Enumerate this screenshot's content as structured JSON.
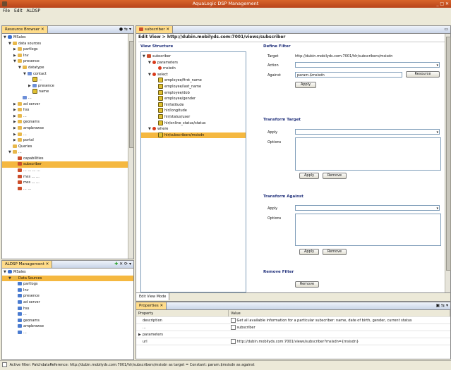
{
  "window": {
    "title": "AquaLogic DSP Management"
  },
  "menu": {
    "file": "File",
    "edit": "Edit",
    "aldsp": "ALDSP"
  },
  "left_panel": {
    "tab": "Resource Browser",
    "items": [
      {
        "label": "MSales",
        "indent": 0,
        "icon": "db",
        "tri": "▼"
      },
      {
        "label": "data sources",
        "indent": 1,
        "icon": "folder",
        "tri": "▼"
      },
      {
        "label": "partlogs",
        "indent": 2,
        "icon": "folder",
        "tri": "▶"
      },
      {
        "label": "Inv",
        "indent": 2,
        "icon": "folder",
        "tri": "▶"
      },
      {
        "label": "presence",
        "indent": 2,
        "icon": "folder",
        "tri": "▼"
      },
      {
        "label": "datatype",
        "indent": 3,
        "icon": "folder",
        "tri": "▼"
      },
      {
        "label": "contact",
        "indent": 4,
        "icon": "cube",
        "tri": "▼"
      },
      {
        "label": "...",
        "indent": 5,
        "icon": "col",
        "tri": ""
      },
      {
        "label": "presence",
        "indent": 5,
        "icon": "cube",
        "tri": "▶"
      },
      {
        "label": "name",
        "indent": 5,
        "icon": "col",
        "tri": ""
      },
      {
        "label": "...",
        "indent": 3,
        "icon": "cube",
        "tri": ""
      },
      {
        "label": "ad server",
        "indent": 2,
        "icon": "folder",
        "tri": "▶"
      },
      {
        "label": "hss",
        "indent": 2,
        "icon": "folder",
        "tri": "▶"
      },
      {
        "label": "...",
        "indent": 2,
        "icon": "folder",
        "tri": "▶"
      },
      {
        "label": "geonams",
        "indent": 2,
        "icon": "folder",
        "tri": "▶"
      },
      {
        "label": "ampbrowse",
        "indent": 2,
        "icon": "folder",
        "tri": "▶"
      },
      {
        "label": "...",
        "indent": 2,
        "icon": "folder",
        "tri": "▶"
      },
      {
        "label": "portal",
        "indent": 2,
        "icon": "folder",
        "tri": "▶"
      },
      {
        "label": "Queries",
        "indent": 1,
        "icon": "folder",
        "tri": ""
      },
      {
        "label": "...",
        "indent": 1,
        "icon": "folder",
        "tri": "▼"
      },
      {
        "label": "capabilities",
        "indent": 2,
        "icon": "view",
        "tri": ""
      },
      {
        "label": "subscriber",
        "indent": 2,
        "icon": "view",
        "tri": "",
        "selected": true
      },
      {
        "label": "... ... ... ...",
        "indent": 2,
        "icon": "view",
        "tri": ""
      },
      {
        "label": "mss ... ...",
        "indent": 2,
        "icon": "view",
        "tri": ""
      },
      {
        "label": "mss ... ...",
        "indent": 2,
        "icon": "view",
        "tri": ""
      },
      {
        "label": "... ...",
        "indent": 2,
        "icon": "view",
        "tri": ""
      }
    ]
  },
  "left_bottom_panel": {
    "tab": "ALDSP Management",
    "items": [
      {
        "label": "MSales",
        "indent": 0,
        "icon": "db",
        "tri": "▼"
      },
      {
        "label": "Data Sources",
        "indent": 1,
        "icon": "folder",
        "tri": "▼",
        "selected": true
      },
      {
        "label": "partlogs",
        "indent": 2,
        "icon": "table",
        "tri": ""
      },
      {
        "label": "Inv",
        "indent": 2,
        "icon": "table",
        "tri": ""
      },
      {
        "label": "presence",
        "indent": 2,
        "icon": "table",
        "tri": ""
      },
      {
        "label": "ad server",
        "indent": 2,
        "icon": "table",
        "tri": ""
      },
      {
        "label": "hss",
        "indent": 2,
        "icon": "table",
        "tri": ""
      },
      {
        "label": "...",
        "indent": 2,
        "icon": "table",
        "tri": ""
      },
      {
        "label": "geonams",
        "indent": 2,
        "icon": "table",
        "tri": ""
      },
      {
        "label": "ampbrowse",
        "indent": 2,
        "icon": "table",
        "tri": ""
      },
      {
        "label": "...",
        "indent": 2,
        "icon": "table",
        "tri": ""
      }
    ]
  },
  "editor": {
    "tab": "subscriber",
    "header": "Edit View > http://dubin.mobilyds.com:7001/views/subscriber",
    "view_structure_title": "View Structure",
    "structure": [
      {
        "label": "subscriber",
        "indent": 0,
        "icon": "view",
        "tri": "▼"
      },
      {
        "label": "parameters",
        "indent": 1,
        "icon": "key",
        "tri": "▼"
      },
      {
        "label": "msisdn",
        "indent": 2,
        "icon": "key",
        "tri": ""
      },
      {
        "label": "select",
        "indent": 1,
        "icon": "key",
        "tri": "▼"
      },
      {
        "label": "employee/first_name",
        "indent": 2,
        "icon": "col",
        "tri": ""
      },
      {
        "label": "employee/last_name",
        "indent": 2,
        "icon": "col",
        "tri": ""
      },
      {
        "label": "employee/dob",
        "indent": 2,
        "icon": "col",
        "tri": ""
      },
      {
        "label": "employee/gender",
        "indent": 2,
        "icon": "col",
        "tri": ""
      },
      {
        "label": "hlr/latitude",
        "indent": 2,
        "icon": "col",
        "tri": ""
      },
      {
        "label": "hlr/longitude",
        "indent": 2,
        "icon": "col",
        "tri": ""
      },
      {
        "label": "hlr/status/user",
        "indent": 2,
        "icon": "col",
        "tri": ""
      },
      {
        "label": "hlr/online_status/status",
        "indent": 2,
        "icon": "col",
        "tri": ""
      },
      {
        "label": "where",
        "indent": 1,
        "icon": "key",
        "tri": "▼"
      },
      {
        "label": "hlr/subscribers/msisdn",
        "indent": 2,
        "icon": "col",
        "tri": "",
        "selected": true
      }
    ],
    "define_filter": {
      "title": "Define Filter",
      "target_label": "Target",
      "target_value": "http://dubin.mobilyds.com:7001/hlr/subscribers/msisdn",
      "action_label": "Action",
      "against_label": "Against",
      "against_value": "param.$msisdn",
      "resource_button": "Resource",
      "apply_button": "Apply"
    },
    "transform_target": {
      "title": "Transform Target",
      "apply_label": "Apply",
      "options_label": "Options",
      "apply_button": "Apply",
      "remove_button": "Remove"
    },
    "transform_against": {
      "title": "Transform Against",
      "apply_label": "Apply",
      "options_label": "Options",
      "apply_button": "Apply",
      "remove_button": "Remove"
    },
    "remove_filter": {
      "title": "Remove Filter",
      "button": "Remove"
    },
    "bottom_tab": "Edit View Mode"
  },
  "properties": {
    "tab": "Properties",
    "col_property": "Property",
    "col_value": "Value",
    "rows": [
      {
        "name": "description",
        "value": "Get all available information for a particular subscriber: name, date of birth, gender, current status",
        "tri": ""
      },
      {
        "name": "...",
        "value": "subscriber",
        "tri": ""
      },
      {
        "name": "parameters",
        "value": "",
        "tri": "▶"
      },
      {
        "name": "url",
        "value": "http://dubin.mobilyds.com:7001/views/subscriber?msisdn={msisdn}",
        "tri": ""
      }
    ]
  },
  "status": {
    "text": "Active filter: PatchdataReference: http://dubin.mobilyds.com:7001/hlr/subscribers/msisdn as target = Constant: param.$msisdn as against"
  }
}
